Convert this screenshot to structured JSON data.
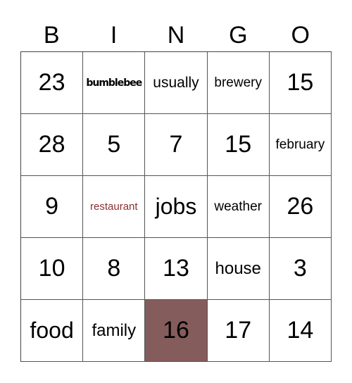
{
  "header": [
    "B",
    "I",
    "N",
    "G",
    "O"
  ],
  "colors": {
    "marked_cell": "#855c5c",
    "restaurant_text": "#8b2e2e"
  },
  "cells": [
    [
      {
        "text": "23",
        "style": "num"
      },
      {
        "text": "bumblebee",
        "style": "bold"
      },
      {
        "text": "usually",
        "style": "sm"
      },
      {
        "text": "brewery",
        "style": "xs"
      },
      {
        "text": "15",
        "style": "num"
      }
    ],
    [
      {
        "text": "28",
        "style": "num"
      },
      {
        "text": "5",
        "style": "num"
      },
      {
        "text": "7",
        "style": "num"
      },
      {
        "text": "15",
        "style": "num"
      },
      {
        "text": "february",
        "style": "xs"
      }
    ],
    [
      {
        "text": "9",
        "style": "num"
      },
      {
        "text": "restaurant",
        "style": "tiny"
      },
      {
        "text": "jobs",
        "style": "big"
      },
      {
        "text": "weather",
        "style": "xs"
      },
      {
        "text": "26",
        "style": "num"
      }
    ],
    [
      {
        "text": "10",
        "style": "num"
      },
      {
        "text": "8",
        "style": "num"
      },
      {
        "text": "13",
        "style": "num"
      },
      {
        "text": "house",
        "style": "med"
      },
      {
        "text": "3",
        "style": "num"
      }
    ],
    [
      {
        "text": "food",
        "style": "big"
      },
      {
        "text": "family",
        "style": "med"
      },
      {
        "text": "16",
        "style": "num",
        "marked": true
      },
      {
        "text": "17",
        "style": "num"
      },
      {
        "text": "14",
        "style": "num"
      }
    ]
  ]
}
